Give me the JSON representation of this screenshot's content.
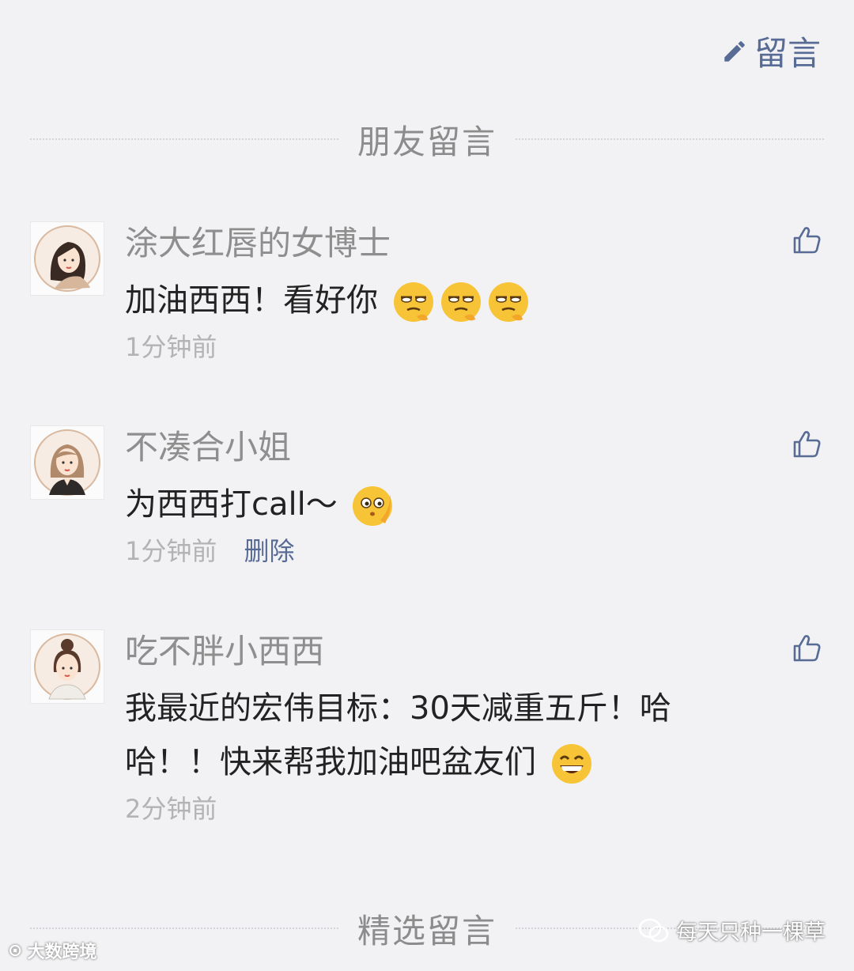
{
  "header": {
    "write_label": "留言",
    "icon": "pencil-icon",
    "accent": "#576b95"
  },
  "sections": {
    "friends_label": "朋友留言",
    "selected_label": "精选留言"
  },
  "comments": [
    {
      "nickname": "涂大红唇的女博士",
      "text": "加油西西！看好你",
      "emojis": [
        "smirk-emoji",
        "smirk-emoji",
        "smirk-emoji"
      ],
      "time": "1分钟前",
      "delete_label": ""
    },
    {
      "nickname": "不凑合小姐",
      "text": "为西西打call～",
      "emojis": [
        "curious-emoji"
      ],
      "time": "1分钟前",
      "delete_label": "删除"
    },
    {
      "nickname": "吃不胖小西西",
      "text": "我最近的宏伟目标：30天减重五斤！哈哈！！快来帮我加油吧盆友们",
      "emojis": [
        "grin-emoji"
      ],
      "time": "2分钟前",
      "delete_label": ""
    }
  ],
  "watermarks": {
    "left": "大数跨境",
    "right": "每天只种一棵草"
  }
}
